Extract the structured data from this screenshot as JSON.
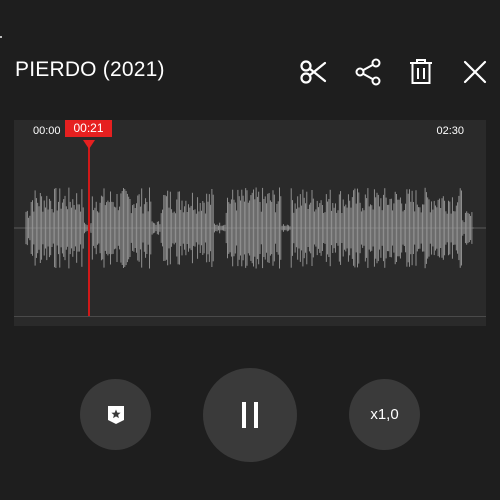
{
  "header": {
    "title": "PIERDO (2021)"
  },
  "toolbar": {
    "icons": [
      "scissors-icon",
      "share-icon",
      "trash-icon",
      "close-icon"
    ]
  },
  "timeline": {
    "start_time": "00:00",
    "current_time": "00:21",
    "end_time": "02:30",
    "playhead_fraction": 0.14
  },
  "controls": {
    "bookmark_icon": "bookmark-star-icon",
    "pause_icon": "pause-icon",
    "speed_label": "x1,0"
  },
  "colors": {
    "background": "#1e1e1e",
    "panel": "#2a2a2a",
    "waveform": "#9a9a9a",
    "playhead": "#e62020",
    "button": "#3a3a3a"
  }
}
